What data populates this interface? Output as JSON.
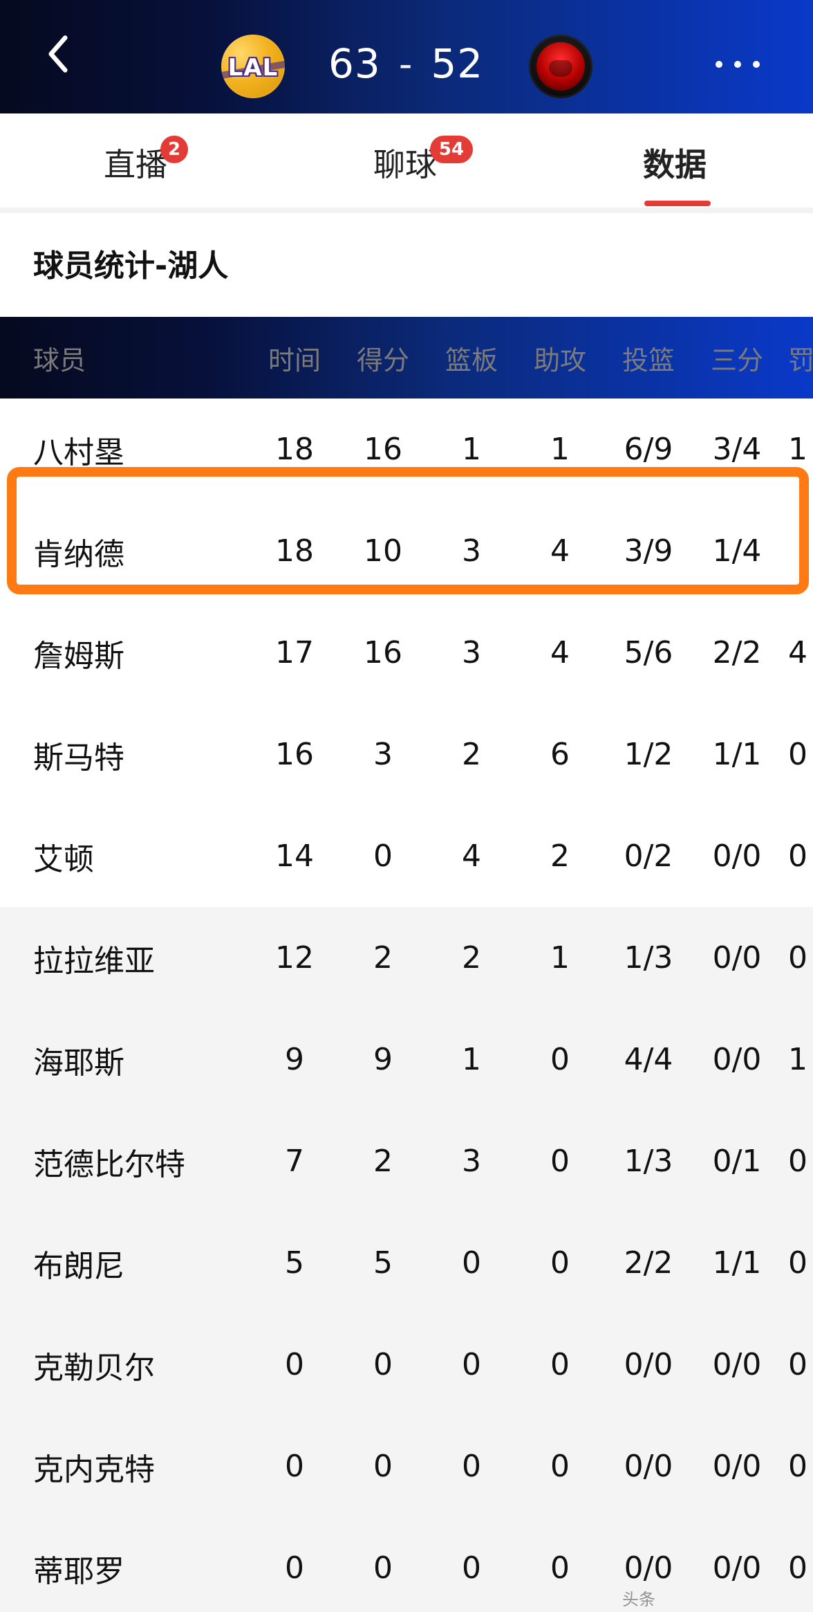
{
  "header": {
    "score_home": "63",
    "score_sep": "-",
    "score_away": "52",
    "home_team_logo_text": "LAL"
  },
  "tabs": [
    {
      "label": "直播",
      "badge": "2"
    },
    {
      "label": "聊球",
      "badge": "54"
    },
    {
      "label": "数据",
      "active": true
    }
  ],
  "section": {
    "title": "球员统计-湖人"
  },
  "table": {
    "columns": [
      "球员",
      "时间",
      "得分",
      "篮板",
      "助攻",
      "投篮",
      "三分",
      "罚"
    ],
    "rows": [
      {
        "name": "八村塁",
        "time": "18",
        "pts": "16",
        "reb": "1",
        "ast": "1",
        "fg": "6/9",
        "tp": "3/4",
        "ft": "1"
      },
      {
        "name": "肯纳德",
        "time": "18",
        "pts": "10",
        "reb": "3",
        "ast": "4",
        "fg": "3/9",
        "tp": "1/4",
        "ft": ""
      },
      {
        "name": "詹姆斯",
        "time": "17",
        "pts": "16",
        "reb": "3",
        "ast": "4",
        "fg": "5/6",
        "tp": "2/2",
        "ft": "4"
      },
      {
        "name": "斯马特",
        "time": "16",
        "pts": "3",
        "reb": "2",
        "ast": "6",
        "fg": "1/2",
        "tp": "1/1",
        "ft": "0"
      },
      {
        "name": "艾顿",
        "time": "14",
        "pts": "0",
        "reb": "4",
        "ast": "2",
        "fg": "0/2",
        "tp": "0/0",
        "ft": "0"
      },
      {
        "name": "拉拉维亚",
        "time": "12",
        "pts": "2",
        "reb": "2",
        "ast": "1",
        "fg": "1/3",
        "tp": "0/0",
        "ft": "0"
      },
      {
        "name": "海耶斯",
        "time": "9",
        "pts": "9",
        "reb": "1",
        "ast": "0",
        "fg": "4/4",
        "tp": "0/0",
        "ft": "1"
      },
      {
        "name": "范德比尔特",
        "time": "7",
        "pts": "2",
        "reb": "3",
        "ast": "0",
        "fg": "1/3",
        "tp": "0/1",
        "ft": "0"
      },
      {
        "name": "布朗尼",
        "time": "5",
        "pts": "5",
        "reb": "0",
        "ast": "0",
        "fg": "2/2",
        "tp": "1/1",
        "ft": "0"
      },
      {
        "name": "克勒贝尔",
        "time": "0",
        "pts": "0",
        "reb": "0",
        "ast": "0",
        "fg": "0/0",
        "tp": "0/0",
        "ft": "0"
      },
      {
        "name": "克内克特",
        "time": "0",
        "pts": "0",
        "reb": "0",
        "ast": "0",
        "fg": "0/0",
        "tp": "0/0",
        "ft": "0"
      },
      {
        "name": "蒂耶罗",
        "time": "0",
        "pts": "0",
        "reb": "0",
        "ast": "0",
        "fg": "0/0",
        "tp": "0/0",
        "ft": "0"
      }
    ]
  },
  "bottom_mark": "头条"
}
